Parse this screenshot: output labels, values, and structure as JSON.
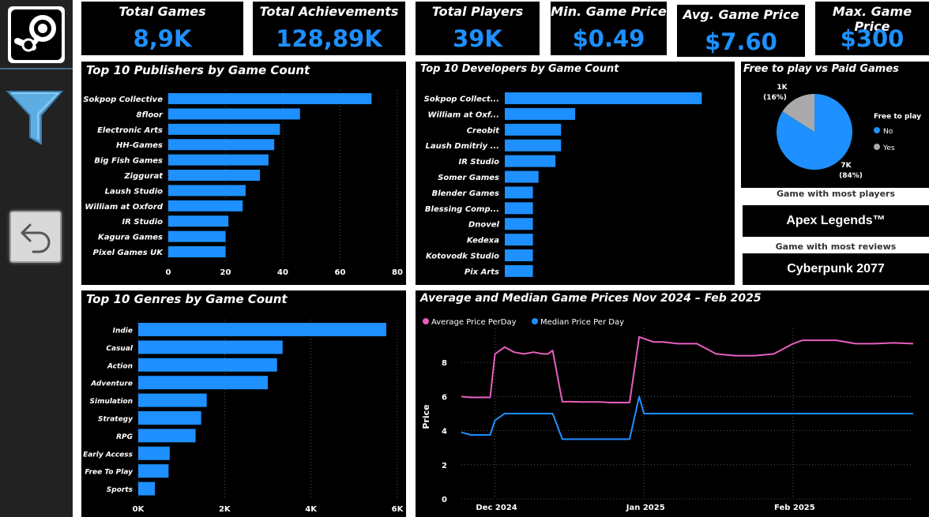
{
  "kpis": [
    {
      "title": "Total Games",
      "value": "8,9K"
    },
    {
      "title": "Total Achievements",
      "value": "128,89K"
    },
    {
      "title": "Total Players",
      "value": "39K"
    },
    {
      "title": "Min. Game Price",
      "value": "$0.49"
    },
    {
      "title": "Avg. Game Price",
      "value": "$7.60"
    },
    {
      "title": "Max. Game Price",
      "value": "$300"
    }
  ],
  "sidebar": {
    "logo_icon": "steam-logo-icon",
    "filter_icon": "filter-funnel-icon",
    "back_icon": "back-arrow-icon",
    "accent": "#5dade2"
  },
  "publishers_chart": {
    "title": "Top 10 Publishers by Game Count",
    "chart_data": {
      "type": "bar",
      "orientation": "horizontal",
      "categories": [
        "Sokpop Collective",
        "8floor",
        "Electronic Arts",
        "HH-Games",
        "Big Fish Games",
        "Ziggurat",
        "Laush Studio",
        "William at Oxford",
        "IR Studio",
        "Kagura Games",
        "Pixel Games UK"
      ],
      "values": [
        71,
        46,
        39,
        37,
        35,
        32,
        27,
        26,
        21,
        20,
        20
      ],
      "xticks": [
        "0",
        "20",
        "40",
        "60",
        "80"
      ],
      "xlim": [
        0,
        80
      ],
      "color": "#1e90ff"
    }
  },
  "developers_chart": {
    "title": "Top 10 Developers by Game Count",
    "chart_data": {
      "type": "bar",
      "orientation": "horizontal",
      "categories": [
        "Sokpop Collect...",
        "William at Oxf...",
        "Creobit",
        "Laush Dmitriy ...",
        "IR Studio",
        "Somer Games",
        "Blender Games",
        "Blessing Comp...",
        "Dnovel",
        "Kedexa",
        "Kotovodk Studio",
        "Pix Arts"
      ],
      "values": [
        70,
        25,
        20,
        20,
        18,
        12,
        10,
        10,
        10,
        10,
        10,
        10
      ],
      "xlim": [
        0,
        80
      ],
      "color": "#1e90ff"
    }
  },
  "genres_chart": {
    "title": "Top 10 Genres by Game Count",
    "chart_data": {
      "type": "bar",
      "orientation": "horizontal",
      "categories": [
        "Indie",
        "Casual",
        "Action",
        "Adventure",
        "Simulation",
        "Strategy",
        "RPG",
        "Early Access",
        "Free To Play",
        "Sports"
      ],
      "values": [
        6700,
        3900,
        3750,
        3500,
        1850,
        1700,
        1550,
        850,
        820,
        450
      ],
      "xticks": [
        "0K",
        "2K",
        "4K",
        "6K"
      ],
      "xlim": [
        0,
        7000
      ],
      "color": "#1e90ff"
    }
  },
  "pie_chart": {
    "title": "Free to play vs Paid Games",
    "legend_title": "Free to play",
    "chart_data": {
      "type": "pie",
      "slices": [
        {
          "name": "No",
          "value": 84,
          "label": "7K",
          "pct": "(84%)",
          "color": "#1e90ff"
        },
        {
          "name": "Yes",
          "value": 16,
          "label": "1K",
          "pct": "(16%)",
          "color": "#a9a9a9"
        }
      ],
      "legend_placement": "right"
    }
  },
  "most_players": {
    "label": "Game with most players",
    "value": "Apex Legends™"
  },
  "most_reviews": {
    "label": "Game with most reviews",
    "value": "Cyberpunk 2077"
  },
  "price_chart": {
    "title": "Average and Median Game Prices Nov 2024 – Feb 2025",
    "chart_data": {
      "type": "line",
      "ylabel": "Price",
      "yticks": [
        "0",
        "2",
        "4",
        "6",
        "8"
      ],
      "ylim": [
        0,
        10
      ],
      "xticks": [
        "Dec 2024",
        "Jan 2025",
        "Feb 2025"
      ],
      "x": [
        "2024-11-24",
        "2024-11-26",
        "2024-11-28",
        "2024-11-30",
        "2024-12-01",
        "2024-12-03",
        "2024-12-05",
        "2024-12-07",
        "2024-12-09",
        "2024-12-11",
        "2024-12-12",
        "2024-12-13",
        "2024-12-15",
        "2024-12-17",
        "2024-12-19",
        "2024-12-21",
        "2024-12-23",
        "2024-12-25",
        "2024-12-27",
        "2024-12-29",
        "2024-12-31",
        "2025-01-01",
        "2025-01-03",
        "2025-01-05",
        "2025-01-08",
        "2025-01-12",
        "2025-01-16",
        "2025-01-20",
        "2025-01-24",
        "2025-01-28",
        "2025-02-01",
        "2025-02-03",
        "2025-02-06",
        "2025-02-10",
        "2025-02-14",
        "2025-02-18",
        "2025-02-22",
        "2025-02-26"
      ],
      "series": [
        {
          "name": "Average Price PerDay",
          "color": "#e75fbf",
          "values": [
            6.0,
            5.95,
            5.95,
            5.95,
            8.5,
            8.9,
            8.6,
            8.5,
            8.6,
            8.5,
            8.5,
            8.7,
            5.7,
            5.7,
            5.68,
            5.68,
            5.68,
            5.65,
            5.65,
            5.65,
            9.5,
            9.4,
            9.2,
            9.2,
            9.1,
            9.1,
            8.5,
            8.4,
            8.4,
            8.5,
            9.1,
            9.3,
            9.3,
            9.3,
            9.1,
            9.1,
            9.15,
            9.1
          ]
        },
        {
          "name": "Median Price Per Day",
          "color": "#1e90ff",
          "values": [
            3.9,
            3.75,
            3.75,
            3.75,
            4.6,
            5.0,
            5.0,
            5.0,
            5.0,
            5.0,
            5.0,
            5.0,
            3.5,
            3.5,
            3.5,
            3.5,
            3.5,
            3.5,
            3.5,
            3.5,
            6.0,
            5.0,
            5.0,
            5.0,
            5.0,
            5.0,
            5.0,
            5.0,
            5.0,
            5.0,
            5.0,
            5.0,
            5.0,
            5.0,
            5.0,
            5.0,
            5.0,
            5.0
          ]
        }
      ],
      "grid": true,
      "legend_placement": "top-left"
    }
  }
}
